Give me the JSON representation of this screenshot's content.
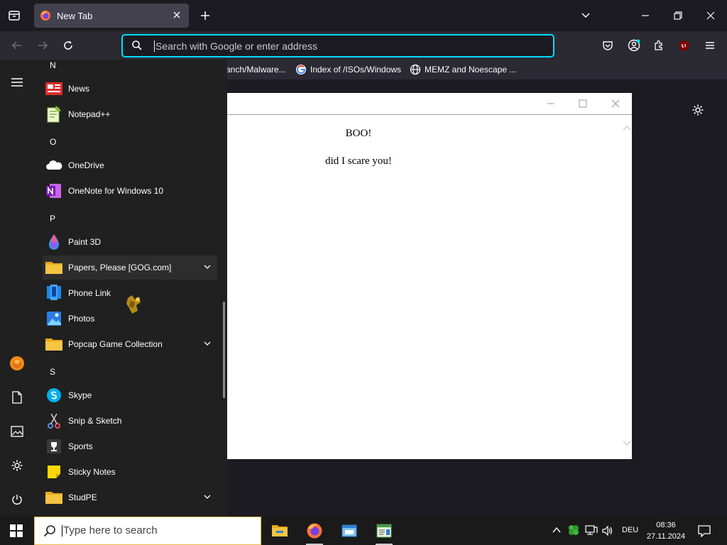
{
  "browser": {
    "tab_title": "New Tab",
    "url_placeholder": "Search with Google or enter address",
    "bookmarks": [
      {
        "label": "ranch/Malware..."
      },
      {
        "label": "Index of /ISOs/Windows"
      },
      {
        "label": "MEMZ and Noescape ..."
      }
    ]
  },
  "popup": {
    "line1": "BOO!",
    "line2": "did I scare you!"
  },
  "start_menu": {
    "letters": {
      "n": "N",
      "o": "O",
      "p": "P",
      "s": "S"
    },
    "apps": [
      {
        "label": "News"
      },
      {
        "label": "Notepad++"
      },
      {
        "label": "OneDrive"
      },
      {
        "label": "OneNote for Windows 10"
      },
      {
        "label": "Paint 3D"
      },
      {
        "label": "Papers, Please [GOG.com]"
      },
      {
        "label": "Phone Link"
      },
      {
        "label": "Photos"
      },
      {
        "label": "Popcap Game Collection"
      },
      {
        "label": "Skype"
      },
      {
        "label": "Snip & Sketch"
      },
      {
        "label": "Sports"
      },
      {
        "label": "Sticky Notes"
      },
      {
        "label": "StudPE"
      }
    ]
  },
  "taskbar": {
    "search_placeholder": "Type here to search",
    "language": "DEU",
    "time": "08:36",
    "date": "27.11.2024"
  },
  "colors": {
    "browser_accent": "#00ddff",
    "start_menu_bg": "#202020",
    "folder_yellow": "#f4c542"
  }
}
